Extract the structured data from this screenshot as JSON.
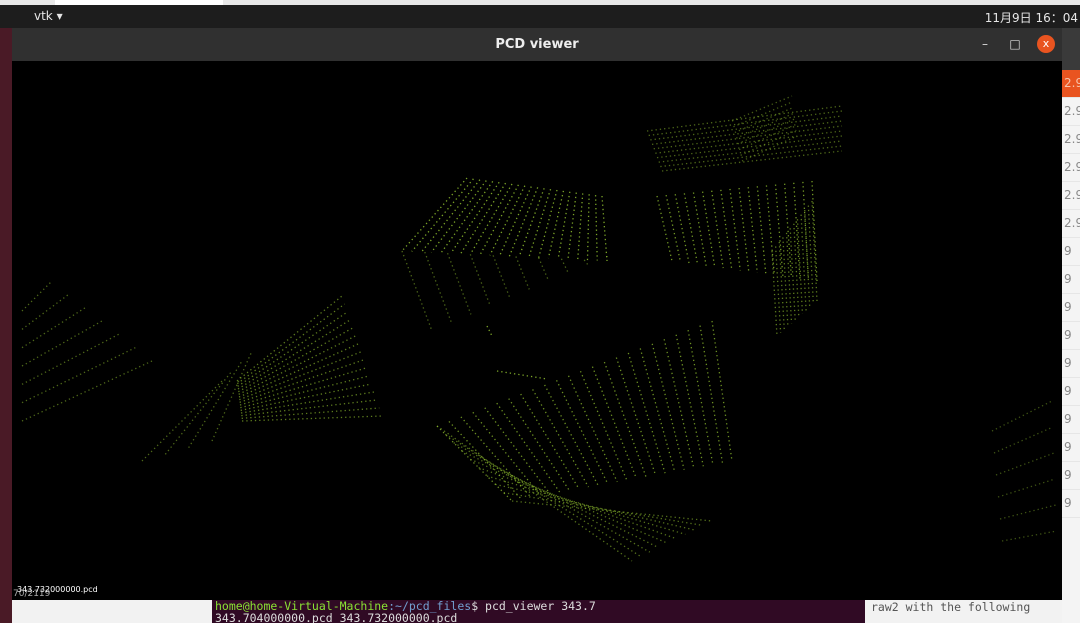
{
  "topbar": {
    "app_menu": "vtk ▾",
    "clock": "11月9日 16：04"
  },
  "window": {
    "title": "PCD viewer",
    "minimize": "–",
    "maximize": "□",
    "close": "x"
  },
  "viewer": {
    "filename": "343.732000000.pcd",
    "counter": "70/2119",
    "point_color": "#9acd32"
  },
  "terminal": {
    "user": "home@home-Virtual-Machine",
    "path": ":~/pcd_files",
    "command": "$ pcd_viewer 343.7",
    "output": "343.704000000.pcd  343.732000000.pcd"
  },
  "background_right": {
    "text": "raw2 with the following",
    "rows": [
      "2.9",
      "2.9",
      "2.9",
      "2.9",
      "2.9",
      "2.9",
      "9",
      "9",
      "9",
      "9",
      "9",
      "9",
      "9",
      "9",
      "9",
      "9"
    ]
  },
  "colors": {
    "accent": "#e95420",
    "terminal_bg": "#300a24"
  }
}
